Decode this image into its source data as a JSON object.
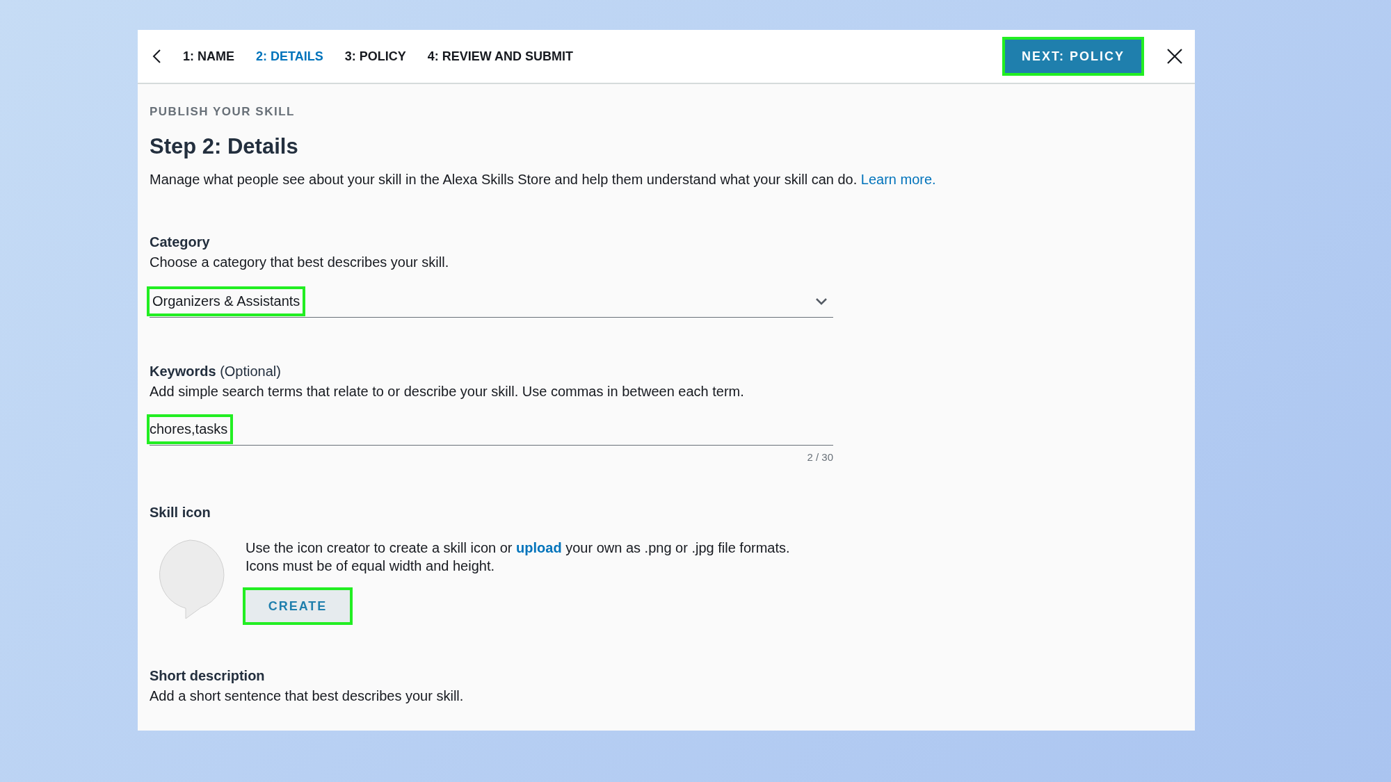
{
  "header": {
    "steps": [
      {
        "label": "1: NAME",
        "selected": false
      },
      {
        "label": "2: DETAILS",
        "selected": true
      },
      {
        "label": "3: POLICY",
        "selected": false
      },
      {
        "label": "4: REVIEW AND SUBMIT",
        "selected": false
      }
    ],
    "next_button": {
      "label": "NEXT: POLICY",
      "highlighted": true
    }
  },
  "eyebrow": "PUBLISH YOUR SKILL",
  "title": "Step 2: Details",
  "intro": {
    "text": "Manage what people see about your skill in the Alexa Skills Store and help them understand what your skill can do.",
    "link": "Learn more."
  },
  "category": {
    "label": "Category",
    "help": "Choose a category that best describes your skill.",
    "value": "Organizers & Assistants",
    "highlighted": true
  },
  "keywords": {
    "label": "**Keywords** (Optional)",
    "help": "Add simple search terms that relate to or describe your skill. Use commas in between each term.",
    "value": "chores,tasks",
    "highlighted": true,
    "counter": "2 / 30"
  },
  "skill_icon": {
    "label": "Skill icon",
    "text_before": "Use the icon creator to create a skill icon or",
    "link": "upload",
    "text_after": "your own as .png or .jpg file formats.",
    "text_line2": "Icons must be of equal width and height.",
    "create_button": {
      "label": "CREATE",
      "highlighted": true
    }
  },
  "short_description": {
    "label": "Short description",
    "help": "Add a short sentence that best describes your skill."
  }
}
